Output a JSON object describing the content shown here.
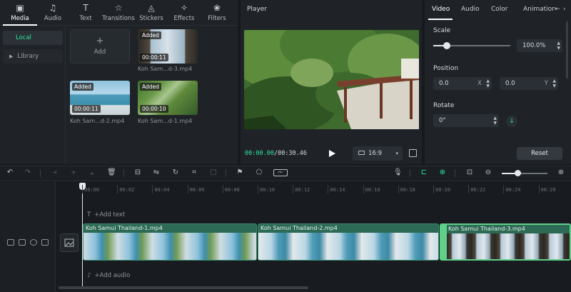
{
  "media_tabs": [
    {
      "label": "Media",
      "icon": "media-icon",
      "active": true
    },
    {
      "label": "Audio",
      "icon": "audio-icon"
    },
    {
      "label": "Text",
      "icon": "text-icon"
    },
    {
      "label": "Transitions",
      "icon": "transitions-icon"
    },
    {
      "label": "Stickers",
      "icon": "stickers-icon"
    },
    {
      "label": "Effects",
      "icon": "effects-icon"
    },
    {
      "label": "Filters",
      "icon": "filters-icon"
    }
  ],
  "sidebar": {
    "local": "Local",
    "library": "Library"
  },
  "media": {
    "add_label": "Add",
    "items": [
      {
        "name": "Koh Sam...d-3.mp4",
        "badge": "Added",
        "duration": "00:00:11"
      },
      {
        "name": "Koh Sam...d-2.mp4",
        "badge": "Added",
        "duration": "00:00:11"
      },
      {
        "name": "Koh Sam...d-1.mp4",
        "badge": "Added",
        "duration": "00:00:10"
      }
    ]
  },
  "player": {
    "title": "Player",
    "time_current": "00:00.00",
    "time_total": "/00:30.46",
    "ratio": "16:9"
  },
  "props": {
    "tabs": [
      "Video",
      "Audio",
      "Color",
      "Animation"
    ],
    "scale_label": "Scale",
    "scale_value": "100.0%",
    "scale_level": 0.18,
    "position_label": "Position",
    "pos_x": "0.0",
    "pos_x_axis": "X",
    "pos_y": "0.0",
    "pos_y_axis": "Y",
    "rotate_label": "Rotate",
    "rotate_value": "0°",
    "reset_label": "Reset"
  },
  "timeline": {
    "ticks": [
      "00:00",
      "00:02",
      "00:04",
      "00:06",
      "00:08",
      "00:10",
      "00:12",
      "00:14",
      "00:16",
      "00:18",
      "00:20",
      "00:22",
      "00:24",
      "00:26"
    ],
    "add_text": "+Add text",
    "add_audio": "+Add audio",
    "clips": [
      "Koh Samui Thailand-1.mp4",
      "Koh Samui Thailand-2.mp4",
      "Koh Samui Thailand-3.mp4"
    ],
    "zoom_level": 0.35
  },
  "colors": {
    "accent": "#2ee59d",
    "clip": "#2d6a55",
    "selected": "#5fcf8a"
  }
}
